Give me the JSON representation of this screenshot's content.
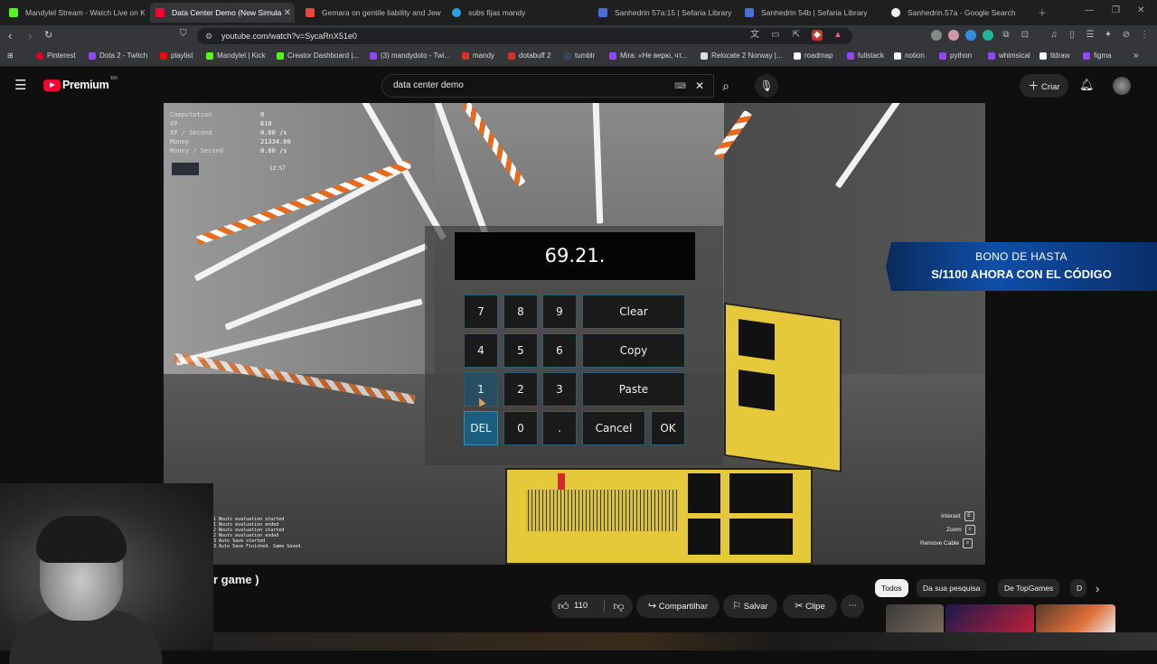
{
  "tabs": [
    {
      "title": "Mandylel Stream - Watch Live on Ki",
      "color": "#53fc18",
      "active": false
    },
    {
      "title": "Data Center Demo (New Simula",
      "color": "#ff0033",
      "active": true
    },
    {
      "title": "Gemara on gentile liability and Jewi",
      "color": "#e24b3b",
      "active": false
    },
    {
      "title": "subs fijas mandy",
      "color": "#2aa3e0",
      "active": false
    },
    {
      "title": "Sanhedrin 57a:15 | Sefaria Library",
      "color": "#4a6fd8",
      "active": false
    },
    {
      "title": "Sanhedrin 54b | Sefaria Library",
      "color": "#4a6fd8",
      "active": false
    },
    {
      "title": "Sanhedrin.57a - Google Search",
      "color": "#f1f1f1",
      "active": false
    }
  ],
  "address": {
    "url": "youtube.com/watch?v=SycaRnX51e0"
  },
  "bookmarks": [
    {
      "label": "Pinterest",
      "color": "#e60023"
    },
    {
      "label": "Dota 2 - Twitch",
      "color": "#9146ff"
    },
    {
      "label": "playlist",
      "color": "#ff0000"
    },
    {
      "label": "Mandylel | Kick",
      "color": "#53fc18"
    },
    {
      "label": "Creator Dashboard |...",
      "color": "#53fc18"
    },
    {
      "label": "(3) mandydoto - Twi...",
      "color": "#9146ff"
    },
    {
      "label": "mandy",
      "color": "#d93025"
    },
    {
      "label": "dotabuff 2",
      "color": "#d93025"
    },
    {
      "label": "tumblr",
      "color": "#35465c"
    },
    {
      "label": "Mira: «Не верю, чт...",
      "color": "#9146ff"
    },
    {
      "label": "Relocate 2 Norway |...",
      "color": "#dddddd"
    },
    {
      "label": "roadmap",
      "color": "#ffffff"
    },
    {
      "label": "fullstack",
      "color": "#9146ff"
    },
    {
      "label": "notion",
      "color": "#ffffff"
    },
    {
      "label": "python",
      "color": "#9146ff"
    },
    {
      "label": "whimsical",
      "color": "#9146ff"
    },
    {
      "label": "tldraw",
      "color": "#ffffff"
    },
    {
      "label": "figma",
      "color": "#9146ff"
    }
  ],
  "youtube": {
    "logo": "Premium",
    "logo_region": "BR",
    "search_value": "data center demo",
    "create_label": "Criar"
  },
  "game_hud": {
    "lines": [
      "Computation",
      "XP",
      "XP / Second",
      "Money",
      "Money / Second"
    ],
    "values": [
      "0",
      "610",
      "0.00 /s",
      "21334.00",
      "0.00 /s"
    ],
    "time": "12:57",
    "log": [
      "1 Nouts evaluation started",
      "1 Nouts evaluation ended",
      "2 Nouts evaluation started",
      "2 Nouts evaluation ended",
      "3 Auto Save started",
      "3 Auto Save Finished. Game Saved."
    ],
    "controls": [
      {
        "label": "Interact",
        "key": "E"
      },
      {
        "label": "Zoom",
        "key": "⌕"
      },
      {
        "label": "Remove Cable",
        "key": "⌕"
      }
    ]
  },
  "keypad": {
    "display": "69.21.",
    "keys": {
      "k7": "7",
      "k8": "8",
      "k9": "9",
      "clear": "Clear",
      "k4": "4",
      "k5": "5",
      "k6": "6",
      "copy": "Copy",
      "k1": "1",
      "k2": "2",
      "k3": "3",
      "paste": "Paste",
      "del": "DEL",
      "k0": "0",
      "dot": ".",
      "cancel": "Cancel",
      "ok": "OK"
    }
  },
  "ad": {
    "line1": "BONO DE HASTA",
    "line2": "S/1100 AHORA CON EL CÓDIGO"
  },
  "video": {
    "title_fragment": "r game )"
  },
  "actions": {
    "likes": "110",
    "share": "Compartilhar",
    "save": "Salvar",
    "clip": "Clipe",
    "more": "⋯"
  },
  "chips": [
    "Todos",
    "Da sua pesquisa",
    "De TopGames",
    "D"
  ]
}
